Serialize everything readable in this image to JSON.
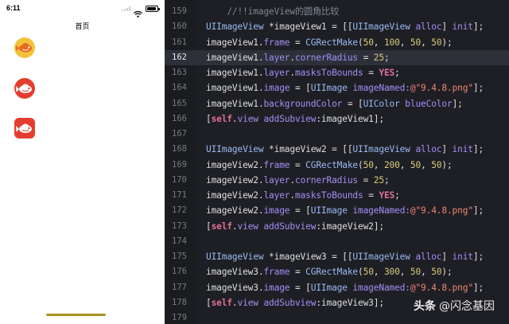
{
  "simulator": {
    "status_time": "6:11",
    "nav_title": "首页",
    "image_views": [
      {
        "name": "image-view-1",
        "shape": "circle",
        "background": "#f2c33a"
      },
      {
        "name": "image-view-2",
        "shape": "circle",
        "background": "#e43d2f"
      },
      {
        "name": "image-view-3",
        "shape": "rounded-square",
        "background": "#e43d2f"
      }
    ],
    "icons": [
      "signal-icon",
      "wifi-icon",
      "battery-icon",
      "fish-logo-icon"
    ]
  },
  "editor": {
    "current_line": "162",
    "colors": {
      "background": "#1e1f24",
      "keyword": "#e0709a",
      "class": "#9ab9f2",
      "property": "#a48ef5",
      "string": "#ef8577",
      "number": "#d9c97c",
      "comment": "#7d8794"
    },
    "lines": [
      {
        "n": "159",
        "tokens": [
          {
            "t": "comment",
            "v": "    //!!imageView的圆角比较"
          }
        ]
      },
      {
        "n": "160",
        "tokens": [
          {
            "t": "class",
            "v": "UIImageView"
          },
          {
            "t": "plain",
            "v": " *imageView1 = [["
          },
          {
            "t": "class",
            "v": "UIImageView"
          },
          {
            "t": "prop",
            "v": " alloc"
          },
          {
            "t": "plain",
            "v": "] "
          },
          {
            "t": "prop",
            "v": "init"
          },
          {
            "t": "plain",
            "v": "];"
          }
        ]
      },
      {
        "n": "161",
        "tokens": [
          {
            "t": "plain",
            "v": "imageView1."
          },
          {
            "t": "prop",
            "v": "frame"
          },
          {
            "t": "plain",
            "v": " = "
          },
          {
            "t": "class",
            "v": "CGRectMake"
          },
          {
            "t": "plain",
            "v": "("
          },
          {
            "t": "num",
            "v": "50"
          },
          {
            "t": "plain",
            "v": ", "
          },
          {
            "t": "num",
            "v": "100"
          },
          {
            "t": "plain",
            "v": ", "
          },
          {
            "t": "num",
            "v": "50"
          },
          {
            "t": "plain",
            "v": ", "
          },
          {
            "t": "num",
            "v": "50"
          },
          {
            "t": "plain",
            "v": ");"
          }
        ]
      },
      {
        "n": "162",
        "tokens": [
          {
            "t": "plain",
            "v": "imageView1."
          },
          {
            "t": "prop",
            "v": "layer"
          },
          {
            "t": "plain",
            "v": "."
          },
          {
            "t": "prop",
            "v": "cornerRadius"
          },
          {
            "t": "plain",
            "v": " = "
          },
          {
            "t": "num",
            "v": "25"
          },
          {
            "t": "plain",
            "v": ";"
          }
        ]
      },
      {
        "n": "163",
        "tokens": [
          {
            "t": "plain",
            "v": "imageView1."
          },
          {
            "t": "prop",
            "v": "layer"
          },
          {
            "t": "plain",
            "v": "."
          },
          {
            "t": "prop",
            "v": "masksToBounds"
          },
          {
            "t": "plain",
            "v": " = "
          },
          {
            "t": "kw",
            "v": "YES"
          },
          {
            "t": "plain",
            "v": ";"
          }
        ]
      },
      {
        "n": "164",
        "tokens": [
          {
            "t": "plain",
            "v": "imageView1."
          },
          {
            "t": "prop",
            "v": "image"
          },
          {
            "t": "plain",
            "v": " = ["
          },
          {
            "t": "class",
            "v": "UIImage"
          },
          {
            "t": "prop",
            "v": " imageNamed:"
          },
          {
            "t": "str",
            "v": "@\"9.4.8.png\""
          },
          {
            "t": "plain",
            "v": "];"
          }
        ]
      },
      {
        "n": "165",
        "tokens": [
          {
            "t": "plain",
            "v": "imageView1."
          },
          {
            "t": "prop",
            "v": "backgroundColor"
          },
          {
            "t": "plain",
            "v": " = ["
          },
          {
            "t": "class",
            "v": "UIColor"
          },
          {
            "t": "prop",
            "v": " blueColor"
          },
          {
            "t": "plain",
            "v": "];"
          }
        ]
      },
      {
        "n": "166",
        "tokens": [
          {
            "t": "plain",
            "v": "["
          },
          {
            "t": "kw",
            "v": "self"
          },
          {
            "t": "plain",
            "v": "."
          },
          {
            "t": "prop",
            "v": "view"
          },
          {
            "t": "prop",
            "v": " addSubview"
          },
          {
            "t": "plain",
            "v": ":imageView1];"
          }
        ]
      },
      {
        "n": "167",
        "tokens": []
      },
      {
        "n": "168",
        "tokens": [
          {
            "t": "class",
            "v": "UIImageView"
          },
          {
            "t": "plain",
            "v": " *imageView2 = [["
          },
          {
            "t": "class",
            "v": "UIImageView"
          },
          {
            "t": "prop",
            "v": " alloc"
          },
          {
            "t": "plain",
            "v": "] "
          },
          {
            "t": "prop",
            "v": "init"
          },
          {
            "t": "plain",
            "v": "];"
          }
        ]
      },
      {
        "n": "169",
        "tokens": [
          {
            "t": "plain",
            "v": "imageView2."
          },
          {
            "t": "prop",
            "v": "frame"
          },
          {
            "t": "plain",
            "v": " = "
          },
          {
            "t": "class",
            "v": "CGRectMake"
          },
          {
            "t": "plain",
            "v": "("
          },
          {
            "t": "num",
            "v": "50"
          },
          {
            "t": "plain",
            "v": ", "
          },
          {
            "t": "num",
            "v": "200"
          },
          {
            "t": "plain",
            "v": ", "
          },
          {
            "t": "num",
            "v": "50"
          },
          {
            "t": "plain",
            "v": ", "
          },
          {
            "t": "num",
            "v": "50"
          },
          {
            "t": "plain",
            "v": ");"
          }
        ]
      },
      {
        "n": "170",
        "tokens": [
          {
            "t": "plain",
            "v": "imageView2."
          },
          {
            "t": "prop",
            "v": "layer"
          },
          {
            "t": "plain",
            "v": "."
          },
          {
            "t": "prop",
            "v": "cornerRadius"
          },
          {
            "t": "plain",
            "v": " = "
          },
          {
            "t": "num",
            "v": "25"
          },
          {
            "t": "plain",
            "v": ";"
          }
        ]
      },
      {
        "n": "171",
        "tokens": [
          {
            "t": "plain",
            "v": "imageView2."
          },
          {
            "t": "prop",
            "v": "layer"
          },
          {
            "t": "plain",
            "v": "."
          },
          {
            "t": "prop",
            "v": "masksToBounds"
          },
          {
            "t": "plain",
            "v": " = "
          },
          {
            "t": "kw",
            "v": "YES"
          },
          {
            "t": "plain",
            "v": ";"
          }
        ]
      },
      {
        "n": "172",
        "tokens": [
          {
            "t": "plain",
            "v": "imageView2."
          },
          {
            "t": "prop",
            "v": "image"
          },
          {
            "t": "plain",
            "v": " = ["
          },
          {
            "t": "class",
            "v": "UIImage"
          },
          {
            "t": "prop",
            "v": " imageNamed:"
          },
          {
            "t": "str",
            "v": "@\"9.4.8.png\""
          },
          {
            "t": "plain",
            "v": "];"
          }
        ]
      },
      {
        "n": "173",
        "tokens": [
          {
            "t": "plain",
            "v": "["
          },
          {
            "t": "kw",
            "v": "self"
          },
          {
            "t": "plain",
            "v": "."
          },
          {
            "t": "prop",
            "v": "view"
          },
          {
            "t": "prop",
            "v": " addSubview"
          },
          {
            "t": "plain",
            "v": ":imageView2];"
          }
        ]
      },
      {
        "n": "174",
        "tokens": []
      },
      {
        "n": "175",
        "tokens": [
          {
            "t": "class",
            "v": "UIImageView"
          },
          {
            "t": "plain",
            "v": " *imageView3 = [["
          },
          {
            "t": "class",
            "v": "UIImageView"
          },
          {
            "t": "prop",
            "v": " alloc"
          },
          {
            "t": "plain",
            "v": "] "
          },
          {
            "t": "prop",
            "v": "init"
          },
          {
            "t": "plain",
            "v": "];"
          }
        ]
      },
      {
        "n": "176",
        "tokens": [
          {
            "t": "plain",
            "v": "imageView3."
          },
          {
            "t": "prop",
            "v": "frame"
          },
          {
            "t": "plain",
            "v": " = "
          },
          {
            "t": "class",
            "v": "CGRectMake"
          },
          {
            "t": "plain",
            "v": "("
          },
          {
            "t": "num",
            "v": "50"
          },
          {
            "t": "plain",
            "v": ", "
          },
          {
            "t": "num",
            "v": "300"
          },
          {
            "t": "plain",
            "v": ", "
          },
          {
            "t": "num",
            "v": "50"
          },
          {
            "t": "plain",
            "v": ", "
          },
          {
            "t": "num",
            "v": "50"
          },
          {
            "t": "plain",
            "v": ");"
          }
        ]
      },
      {
        "n": "177",
        "tokens": [
          {
            "t": "plain",
            "v": "imageView3."
          },
          {
            "t": "prop",
            "v": "image"
          },
          {
            "t": "plain",
            "v": " = ["
          },
          {
            "t": "class",
            "v": "UIImage"
          },
          {
            "t": "prop",
            "v": " imageNamed:"
          },
          {
            "t": "str",
            "v": "@\"9.4.8.png\""
          },
          {
            "t": "plain",
            "v": "];"
          }
        ]
      },
      {
        "n": "178",
        "tokens": [
          {
            "t": "plain",
            "v": "["
          },
          {
            "t": "kw",
            "v": "self"
          },
          {
            "t": "plain",
            "v": "."
          },
          {
            "t": "prop",
            "v": "view"
          },
          {
            "t": "prop",
            "v": " addSubview"
          },
          {
            "t": "plain",
            "v": ":imageView3];"
          }
        ]
      },
      {
        "n": "179",
        "tokens": []
      }
    ]
  },
  "watermark": {
    "logo": "头条",
    "text": "@闪念基因"
  }
}
